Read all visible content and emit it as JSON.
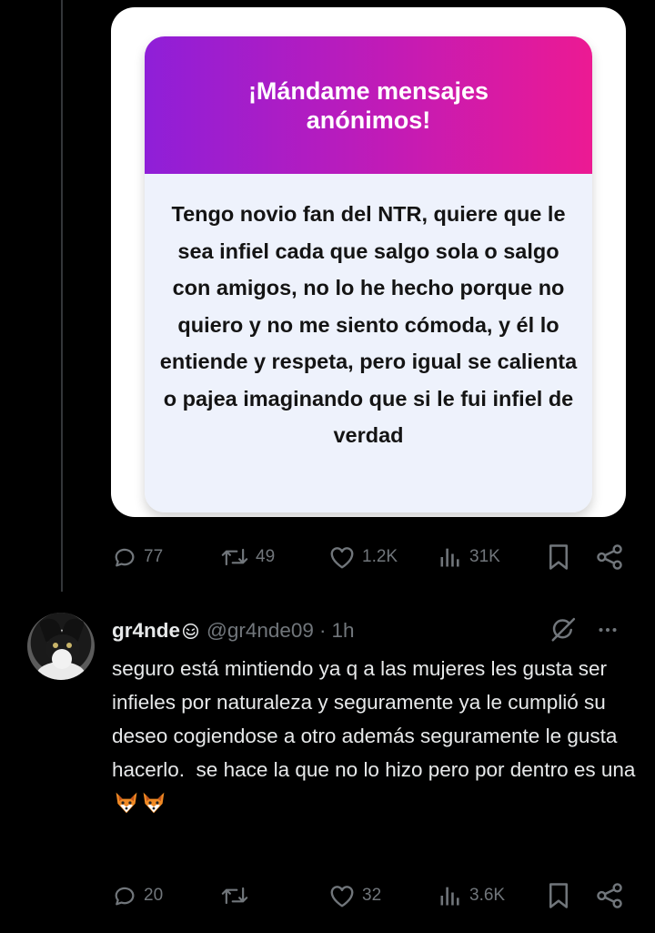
{
  "quoted_post": {
    "card_title": "¡Mándame mensajes anónimos!",
    "card_message": "Tengo novio fan del NTR, quiere que le sea infiel cada que salgo sola o salgo con amigos, no lo he hecho porque no quiero y no me siento cómoda, y él lo entiende y respeta, pero igual se calienta o pajea imaginando que si le fui infiel de verdad",
    "card_gradient": [
      "#8f1fd8",
      "#ec1a93"
    ],
    "actions": {
      "replies": "77",
      "reposts": "49",
      "likes": "1.2K",
      "views": "31K"
    }
  },
  "reply": {
    "display_name": "gr4nde",
    "name_emoji": "smiling-face-emoji",
    "handle": "@gr4nde09",
    "separator": "·",
    "time": "1h",
    "text": "seguro está mintiendo ya q a las mujeres les gusta ser infieles por naturaleza y seguramente ya le cumplió su deseo cogiendose a otro además seguramente le gusta hacerlo.  se hace la que no lo hizo pero por dentro es una",
    "trailing_emojis": [
      "fox-emoji",
      "fox-emoji"
    ],
    "actions": {
      "replies": "20",
      "reposts": "",
      "likes": "32",
      "views": "3.6K"
    }
  },
  "colors": {
    "background": "#000000",
    "text_primary": "#e7e9ea",
    "text_secondary": "#71767b",
    "thread_line": "#333639"
  }
}
